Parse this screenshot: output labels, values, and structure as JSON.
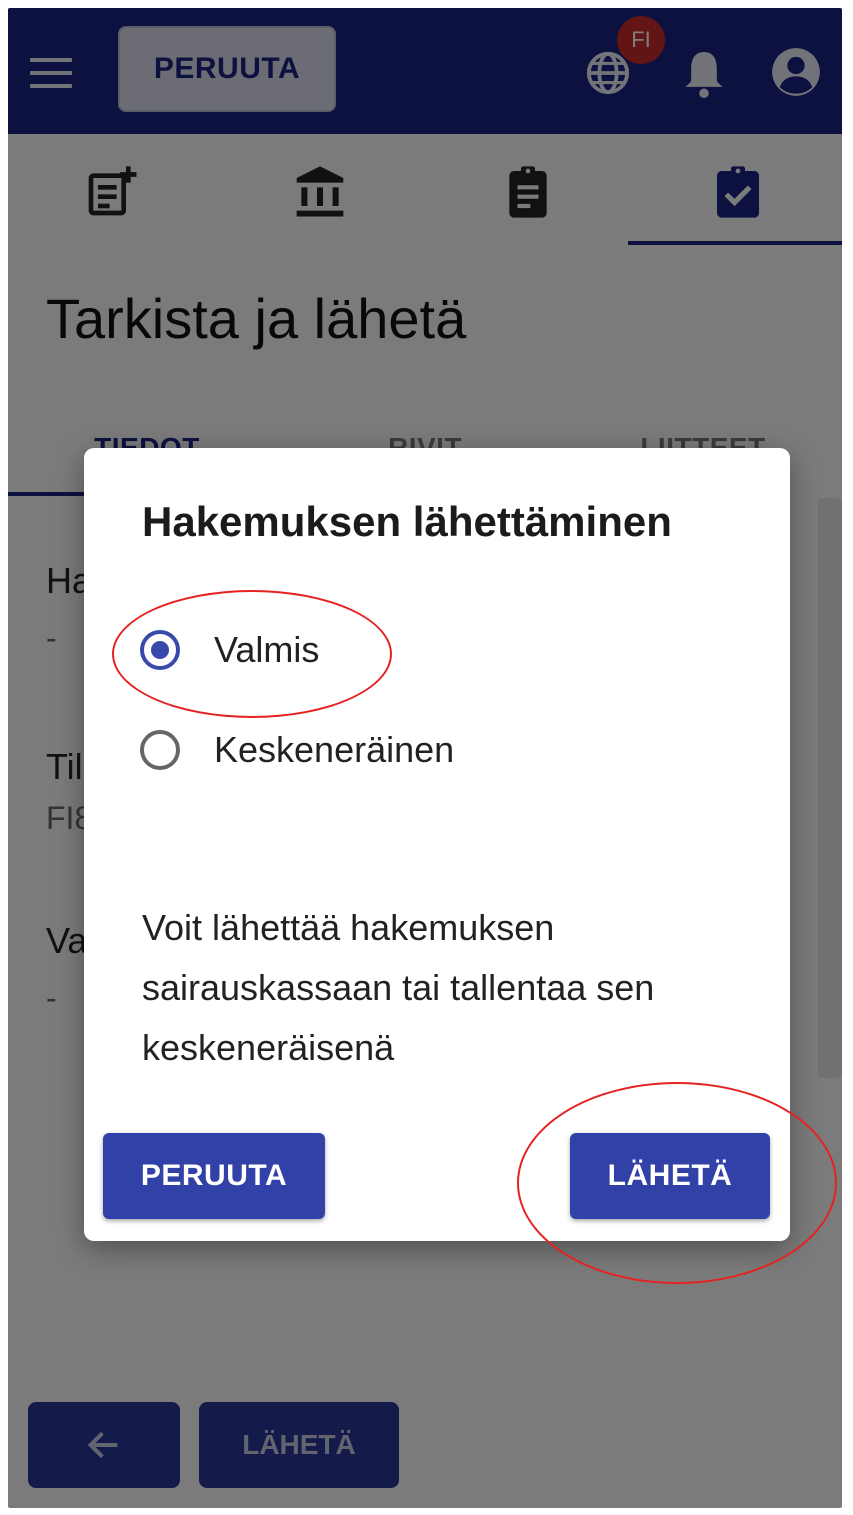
{
  "header": {
    "cancel_label": "PERUUTA",
    "language_badge": "FI",
    "icons": [
      "menu-icon",
      "globe-icon",
      "bell-icon",
      "account-icon"
    ],
    "color": "#1a237e"
  },
  "steps": {
    "icons": [
      "note-add-icon",
      "bank-icon",
      "clipboard-icon",
      "clipboard-check-icon"
    ],
    "active_index": 3
  },
  "page": {
    "title": "Tarkista ja lähetä"
  },
  "tabs": [
    {
      "label": "TIEDOT",
      "active": true
    },
    {
      "label": "RIVIT",
      "active": false
    },
    {
      "label": "LIITTEET",
      "active": false
    }
  ],
  "fields": [
    {
      "label": "Ha",
      "value": "-"
    },
    {
      "label": "Til",
      "value": "FI8"
    },
    {
      "label": "Va",
      "value": "-"
    }
  ],
  "bottom_bar": {
    "send_label": "LÄHETÄ"
  },
  "dialog": {
    "title": "Hakemuksen lähettäminen",
    "options": [
      {
        "label": "Valmis",
        "selected": true
      },
      {
        "label": "Keskeneräinen",
        "selected": false
      }
    ],
    "description": "Voit lähettää hakemuksen sairauskassaan tai tallentaa sen keskeneräisenä",
    "cancel_label": "PERUUTA",
    "send_label": "LÄHETÄ",
    "accent": "#3141a8"
  },
  "annotations": {
    "color": "#e52222",
    "highlighted": [
      "option-valmis",
      "dialog-send-button"
    ]
  }
}
